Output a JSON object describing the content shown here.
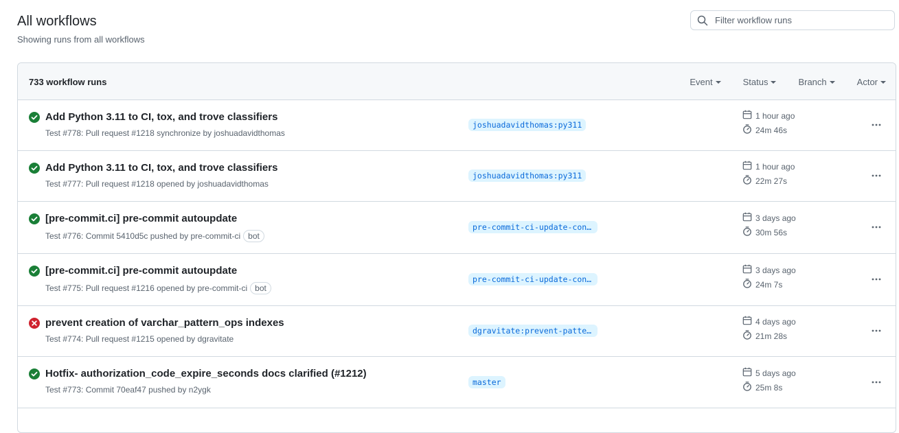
{
  "header": {
    "title": "All workflows",
    "subtitle": "Showing runs from all workflows",
    "search_placeholder": "Filter workflow runs"
  },
  "runs_box": {
    "count_label": "733 workflow runs",
    "filters": [
      "Event",
      "Status",
      "Branch",
      "Actor"
    ]
  },
  "colors": {
    "success": "#1a7f37",
    "failure": "#cf222e",
    "branch_bg": "#ddf4ff",
    "branch_fg": "#0969da"
  },
  "runs": [
    {
      "status": "success",
      "title": "Add Python 3.11 to CI, tox, and trove classifiers",
      "meta": "Test #778: Pull request #1218 synchronize by joshuadavidthomas",
      "bot": "",
      "branch": "joshuadavidthomas:py311",
      "when": "1 hour ago",
      "duration": "24m 46s"
    },
    {
      "status": "success",
      "title": "Add Python 3.11 to CI, tox, and trove classifiers",
      "meta": "Test #777: Pull request #1218 opened by joshuadavidthomas",
      "bot": "",
      "branch": "joshuadavidthomas:py311",
      "when": "1 hour ago",
      "duration": "22m 27s"
    },
    {
      "status": "success",
      "title": "[pre-commit.ci] pre-commit autoupdate",
      "meta": "Test #776: Commit 5410d5c pushed by pre-commit-ci",
      "bot": "bot",
      "branch": "pre-commit-ci-update-config",
      "when": "3 days ago",
      "duration": "30m 56s"
    },
    {
      "status": "success",
      "title": "[pre-commit.ci] pre-commit autoupdate",
      "meta": "Test #775: Pull request #1216 opened by pre-commit-ci",
      "bot": "bot",
      "branch": "pre-commit-ci-update-config",
      "when": "3 days ago",
      "duration": "24m 7s"
    },
    {
      "status": "failure",
      "title": "prevent creation of varchar_pattern_ops indexes",
      "meta": "Test #774: Pull request #1215 opened by dgravitate",
      "bot": "",
      "branch": "dgravitate:prevent-pattern-ops",
      "when": "4 days ago",
      "duration": "21m 28s"
    },
    {
      "status": "success",
      "title": "Hotfix- authorization_code_expire_seconds docs clarified (#1212)",
      "meta": "Test #773: Commit 70eaf47 pushed by n2ygk",
      "bot": "",
      "branch": "master",
      "when": "5 days ago",
      "duration": "25m 8s"
    }
  ]
}
